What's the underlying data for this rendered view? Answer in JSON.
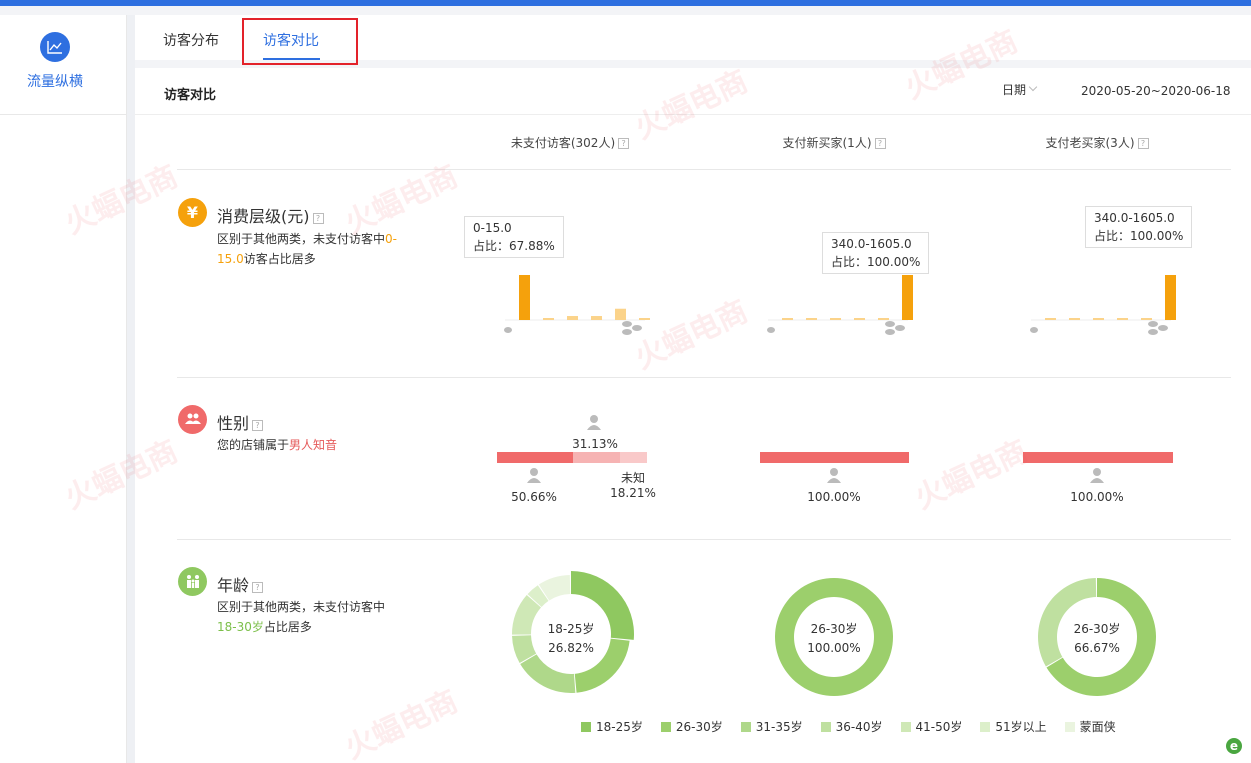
{
  "sidebar": {
    "label": "流量纵横",
    "icon": "line-chart-icon"
  },
  "tabs": [
    {
      "label": "访客分布"
    },
    {
      "label": "访客对比"
    }
  ],
  "panel": {
    "title": "访客对比",
    "date_label": "日期",
    "date_range": "2020-05-20~2020-06-18"
  },
  "columns": [
    {
      "label": "未支付访客(302人)"
    },
    {
      "label": "支付新买家(1人)"
    },
    {
      "label": "支付老买家(3人)"
    }
  ],
  "sections": {
    "spend": {
      "title": "消费层级(元)",
      "icon": "yen-icon",
      "desc_prefix": "区别于其他两类，未支付访客中",
      "desc_highlight": "0-15.0",
      "desc_suffix": "访客占比居多"
    },
    "gender": {
      "title": "性别",
      "icon": "people-icon",
      "desc_prefix": "您的店铺属于",
      "desc_highlight": "男人知音"
    },
    "age": {
      "title": "年龄",
      "icon": "family-icon",
      "desc_prefix": "区别于其他两类，未支付访客中",
      "desc_highlight": "18-30岁",
      "desc_suffix": "占比居多"
    }
  },
  "spend_charts": [
    {
      "tooltip_range": "0-15.0",
      "tooltip_share": "占比：67.88%",
      "values": [
        67.88,
        3,
        6,
        6,
        17,
        1,
        0
      ],
      "highlight_index": 0
    },
    {
      "tooltip_range": "340.0-1605.0",
      "tooltip_share": "占比：100.00%",
      "values": [
        1,
        1,
        1,
        1,
        1,
        100,
        1
      ],
      "highlight_index": 5
    },
    {
      "tooltip_range": "340.0-1605.0",
      "tooltip_share": "占比：100.00%",
      "values": [
        1,
        1,
        1,
        1,
        1,
        100,
        1
      ],
      "highlight_index": 5
    }
  ],
  "gender_charts": [
    {
      "female_pct": "31.13%",
      "male_pct": "50.66%",
      "unknown_label": "未知",
      "unknown_pct": "18.21%",
      "shares": [
        50.66,
        31.13,
        18.21
      ]
    },
    {
      "male_pct": "100.00%",
      "shares": [
        100,
        0,
        0
      ]
    },
    {
      "male_pct": "100.00%",
      "shares": [
        100,
        0,
        0
      ]
    }
  ],
  "age_charts": [
    {
      "center_label": "18-25岁",
      "center_value": "26.82%",
      "slices": [
        26.82,
        22,
        18,
        8,
        12,
        4,
        9.18
      ],
      "highlight_index": 0
    },
    {
      "center_label": "26-30岁",
      "center_value": "100.00%",
      "slices": [
        0,
        100,
        0,
        0,
        0,
        0,
        0
      ],
      "highlight_index": 1
    },
    {
      "center_label": "26-30岁",
      "center_value": "66.67%",
      "slices": [
        0,
        66.67,
        0,
        33.33,
        0,
        0,
        0
      ],
      "highlight_index": 1
    }
  ],
  "age_legend": [
    "18-25岁",
    "26-30岁",
    "31-35岁",
    "36-40岁",
    "41-50岁",
    "51岁以上",
    "蒙面侠"
  ],
  "colors": {
    "accent": "#2e6fe0",
    "highlight_border": "#e3222a",
    "bar_strong": "#f5a10c",
    "bar_light": "#fbd38a",
    "gender_male": "#f06a6a",
    "gender_female": "#f6b3b3",
    "gender_unknown": "#f9c9c9",
    "age": [
      "#8fc860",
      "#9ccf6c",
      "#afd88a",
      "#bfe0a0",
      "#cfe8b6",
      "#dcefca",
      "#eaf4df"
    ]
  }
}
